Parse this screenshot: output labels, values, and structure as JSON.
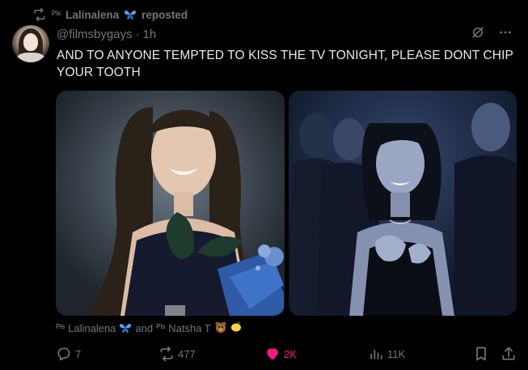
{
  "repost": {
    "badge": "Pls",
    "name": "Lalinalena",
    "label": "reposted"
  },
  "post": {
    "handle": "@filmsbygays",
    "separator": "·",
    "time": "1h",
    "text": "AND TO ANYONE TEMPTED TO KISS THE TV TONIGHT, PLEASE DONT CHIP YOUR TOOTH"
  },
  "tagged": {
    "badge1": "Pls",
    "name1": "Lalinalena",
    "and": "and",
    "badge2": "Pls",
    "name2": "Natsha T"
  },
  "stats": {
    "replies": "7",
    "reposts": "477",
    "likes": "2K",
    "views": "11K"
  },
  "colors": {
    "background": "#000000",
    "text": "#e7e9ea",
    "muted": "#71767b",
    "like": "#f91880",
    "butterfly": "#4ea3ff"
  },
  "icons": [
    "repost-icon",
    "butterfly-icon",
    "grok-icon",
    "more-icon",
    "reply-icon",
    "heart-icon",
    "views-icon",
    "bookmark-icon",
    "share-icon"
  ]
}
